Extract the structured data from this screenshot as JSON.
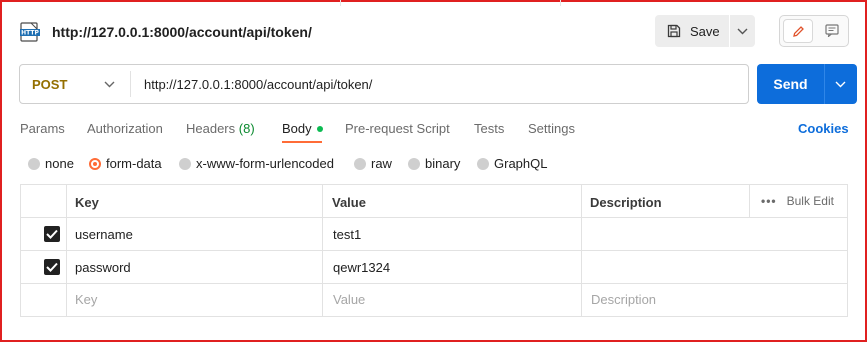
{
  "request": {
    "title": "http://127.0.0.1:8000/account/api/token/",
    "icon": "http-icon",
    "save_label": "Save",
    "method": "POST",
    "url": "http://127.0.0.1:8000/account/api/token/",
    "send_label": "Send"
  },
  "tabs": {
    "params": "Params",
    "authorization": "Authorization",
    "headers": "Headers",
    "headers_count": "(8)",
    "body": "Body",
    "prerequest": "Pre-request Script",
    "tests": "Tests",
    "settings": "Settings",
    "cookies": "Cookies",
    "active": "Body"
  },
  "body_types": {
    "none": "none",
    "form_data": "form-data",
    "urlencoded": "x-www-form-urlencoded",
    "raw": "raw",
    "binary": "binary",
    "graphql": "GraphQL",
    "selected": "form-data"
  },
  "table": {
    "headers": {
      "key": "Key",
      "value": "Value",
      "description": "Description",
      "bulk_edit": "Bulk Edit"
    },
    "rows": [
      {
        "checked": true,
        "key": "username",
        "value": "test1",
        "description": ""
      },
      {
        "checked": true,
        "key": "password",
        "value": "qewr1324",
        "description": ""
      }
    ],
    "placeholders": {
      "key": "Key",
      "value": "Value",
      "description": "Description"
    }
  },
  "colors": {
    "accent": "#ff6c37",
    "send": "#0d6ddb",
    "method": "#946f00",
    "frame": "#e02020"
  }
}
